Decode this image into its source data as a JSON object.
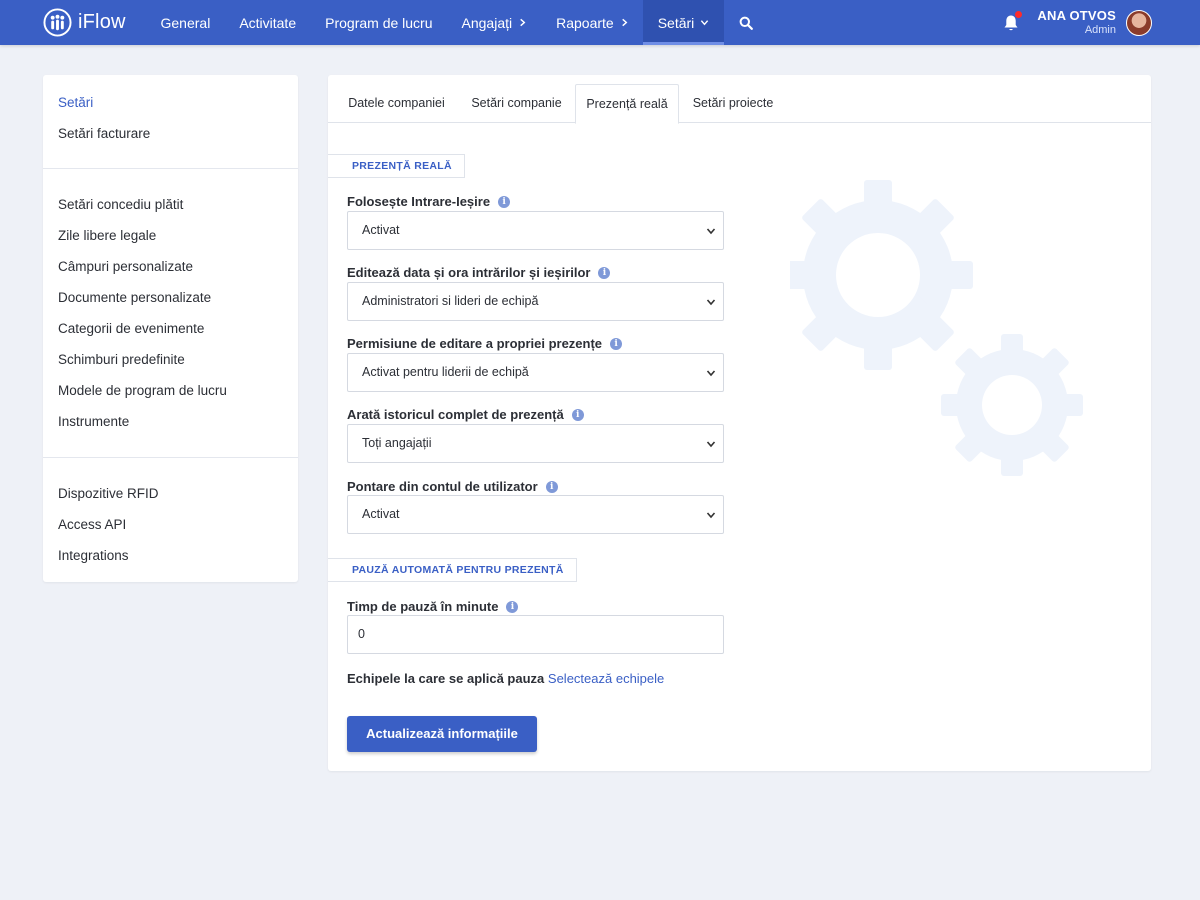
{
  "app": {
    "name": "iFlow"
  },
  "nav": {
    "items": [
      {
        "label": "General"
      },
      {
        "label": "Activitate"
      },
      {
        "label": "Program de lucru"
      },
      {
        "label": "Angajați"
      },
      {
        "label": "Rapoarte"
      },
      {
        "label": "Setări"
      }
    ],
    "active": "Setări"
  },
  "user": {
    "name": "ANA OTVOS",
    "role": "Admin"
  },
  "sidebar": {
    "groups": [
      [
        "Setări",
        "Setări facturare"
      ],
      [
        "Setări concediu plătit",
        "Zile libere legale",
        "Câmpuri personalizate",
        "Documente personalizate",
        "Categorii de evenimente",
        "Schimburi predefinite",
        "Modele de program de lucru",
        "Instrumente"
      ],
      [
        "Dispozitive RFID",
        "Access API",
        "Integrations"
      ]
    ],
    "active": "Setări"
  },
  "tabs": {
    "items": [
      "Datele companiei",
      "Setări companie",
      "Prezență reală",
      "Setări proiecte"
    ],
    "active": "Prezență reală"
  },
  "sections": {
    "presence": "PREZENȚĂ REALĂ",
    "auto_pause": "PAUZĂ AUTOMATĂ PENTRU PREZENȚĂ"
  },
  "fields": [
    {
      "label": "Folosește Intrare-Ieșire",
      "value": "Activat"
    },
    {
      "label": "Editează data și ora intrărilor și ieșirilor",
      "value": "Administratori si lideri de echipă"
    },
    {
      "label": "Permisiune de editare a propriei prezențe",
      "value": "Activat pentru liderii de echipă"
    },
    {
      "label": "Arată istoricul complet de prezență",
      "value": "Toți angajații"
    },
    {
      "label": "Pontare din contul de utilizator",
      "value": "Activat"
    }
  ],
  "pause": {
    "label": "Timp de pauză în minute",
    "value": "0"
  },
  "teams": {
    "label": "Echipele la care se aplică pauza",
    "link": "Selectează echipele"
  },
  "update_button": "Actualizează informațiile",
  "colors": {
    "brand": "#3a5fc5",
    "background": "#eef1f7",
    "notification": "#ff2a2a"
  },
  "icons": [
    "logo-icon",
    "chevron-right-icon",
    "chevron-down-icon",
    "search-icon",
    "bell-icon",
    "info-icon",
    "gear-icon"
  ]
}
